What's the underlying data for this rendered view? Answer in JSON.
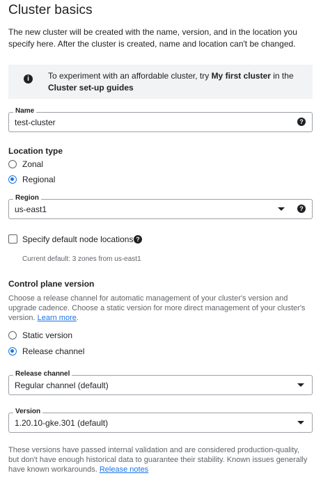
{
  "page": {
    "title": "Cluster basics",
    "intro": "The new cluster will be created with the name, version, and in the location you specify here. After the cluster is created, name and location can't be changed."
  },
  "info_banner": {
    "icon": "info-icon",
    "text_before": "To experiment with an affordable cluster, try ",
    "link1": "My first cluster",
    "text_middle": " in the ",
    "link2": "Cluster set-up guides"
  },
  "name_field": {
    "label": "Name",
    "value": "test-cluster"
  },
  "location_type": {
    "heading": "Location type",
    "options": [
      {
        "label": "Zonal",
        "selected": false
      },
      {
        "label": "Regional",
        "selected": true
      }
    ]
  },
  "region_field": {
    "label": "Region",
    "value": "us-east1"
  },
  "default_node_locations": {
    "label": "Specify default node locations",
    "checked": false,
    "current_default": "Current default: 3 zones from us-east1"
  },
  "control_plane": {
    "heading": "Control plane version",
    "description": "Choose a release channel for automatic management of your cluster's version and upgrade cadence. Choose a static version for more direct management of your cluster's version.",
    "learn_more": "Learn more",
    "options": [
      {
        "label": "Static version",
        "selected": false
      },
      {
        "label": "Release channel",
        "selected": true
      }
    ]
  },
  "release_channel_field": {
    "label": "Release channel",
    "value": "Regular channel (default)"
  },
  "version_field": {
    "label": "Version",
    "value": "1.20.10-gke.301 (default)"
  },
  "footer_note": {
    "text": "These versions have passed internal validation and are considered production-quality, but don't have enough historical data to guarantee their stability. Known issues generally have known workarounds.",
    "link": "Release notes"
  },
  "colors": {
    "accent": "#1a73e8",
    "banner_bg": "#f1f3f4",
    "border": "#9aa0a6",
    "muted_text": "#5f6368"
  }
}
